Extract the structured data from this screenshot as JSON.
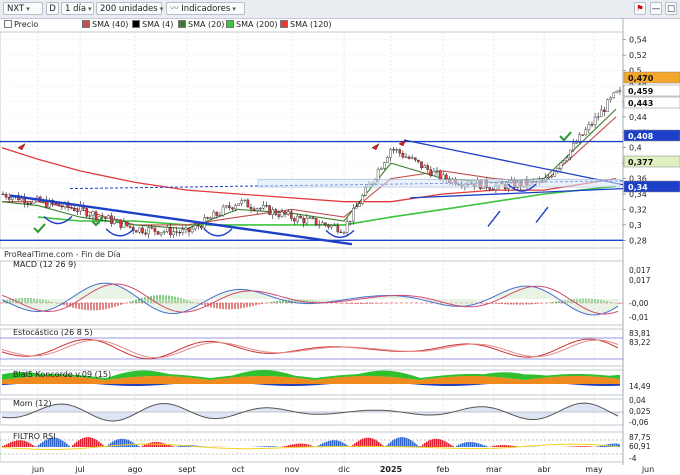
{
  "toolbar": {
    "ticker": "NXT",
    "d_label": "D",
    "period": "1 día",
    "units": "200 unidades",
    "indicators": "Indicadores"
  },
  "legend": {
    "items": [
      {
        "label": "Precio",
        "color": "#ffffff"
      },
      {
        "label": "SMA (40)",
        "color": "#c0504d"
      },
      {
        "label": "SMA (4)",
        "color": "#000000"
      },
      {
        "label": "SMA (20)",
        "color": "#3a7d2a"
      },
      {
        "label": "SMA (200)",
        "color": "#e23a3a"
      },
      {
        "label": "SMA (120)",
        "color": "#e23a3a"
      }
    ]
  },
  "panels": {
    "watermark": "ProRealTime.com - Fin de Día",
    "macd": "MACD (12 26 9)",
    "stoch": "Estocástico (26 8 5)",
    "koncorde": "Blai5 Koncorde v.09 (15)",
    "mom": "Mom (12)",
    "rsi": "FILTRO RSI"
  },
  "months": [
    "jun",
    "jul",
    "ago",
    "sept",
    "oct",
    "nov",
    "dic",
    "2025",
    "feb",
    "mar",
    "abr",
    "may",
    "jun"
  ],
  "price_axis": {
    "ticks": [
      "0,54",
      "0,52",
      "0,5",
      "0,48",
      "0,46",
      "0,44",
      "0,42",
      "0,4",
      "0,38",
      "0,36",
      "0,34",
      "0,32",
      "0,3",
      "0,28"
    ],
    "badges": [
      {
        "text": "0,470",
        "color": "#f4a62a"
      },
      {
        "text": "0,459",
        "color": "#ffffff"
      },
      {
        "text": "0,443",
        "color": "#ffffff"
      },
      {
        "text": "0,408",
        "color": "#1e3fc8"
      },
      {
        "text": "0,377",
        "color": "#e0f0c0"
      },
      {
        "text": "0,34",
        "color": "#1e3fc8"
      }
    ]
  },
  "macd_axis": {
    "ticks": [
      "0,017",
      "0,017",
      "-0,00",
      "-0,01"
    ]
  },
  "stoch_axis": {
    "ticks": [
      "83,81",
      "83,22"
    ]
  },
  "koncorde_axis": {
    "ticks": [
      "14,49"
    ]
  },
  "mom_axis": {
    "ticks": [
      "0,04",
      "0,025",
      "-0,06"
    ]
  },
  "rsi_axis": {
    "ticks": [
      "87,75",
      "60,91",
      "-4"
    ]
  },
  "colors": {
    "up": "#ffffff",
    "down": "#e23a3a",
    "support": "#1e3fc8",
    "sma40": "#c0504d",
    "sma20": "#3a7d2a",
    "sma200": "#3cc43c"
  },
  "chart_data": {
    "type": "line",
    "title": "NXT",
    "xlabel": "",
    "ylabel": "",
    "ylim": [
      0.27,
      0.55
    ],
    "grid": true,
    "x": [
      "2024-05",
      "2024-06",
      "2024-07",
      "2024-08",
      "2024-09",
      "2024-10",
      "2024-11",
      "2024-12",
      "2025-01",
      "2025-02",
      "2025-03",
      "2025-04",
      "2025-05"
    ],
    "series": [
      {
        "name": "Precio",
        "values": [
          0.34,
          0.33,
          0.32,
          0.295,
          0.29,
          0.33,
          0.31,
          0.295,
          0.4,
          0.36,
          0.35,
          0.355,
          0.47
        ]
      },
      {
        "name": "SMA (40)",
        "values": [
          0.33,
          0.33,
          0.32,
          0.3,
          0.3,
          0.31,
          0.32,
          0.31,
          0.36,
          0.37,
          0.36,
          0.355,
          0.44
        ]
      },
      {
        "name": "SMA (20)",
        "values": [
          0.33,
          0.325,
          0.31,
          0.3,
          0.295,
          0.32,
          0.315,
          0.305,
          0.38,
          0.36,
          0.355,
          0.36,
          0.45
        ]
      },
      {
        "name": "SMA (200)",
        "values": [
          null,
          0.31,
          0.305,
          0.305,
          0.3,
          0.3,
          0.3,
          0.3,
          0.31,
          0.32,
          0.33,
          0.34,
          0.35
        ]
      },
      {
        "name": "SMA (120)",
        "values": [
          0.4,
          0.385,
          0.37,
          0.355,
          0.345,
          0.34,
          0.335,
          0.33,
          0.33,
          0.34,
          0.345,
          0.345,
          0.36
        ]
      }
    ]
  }
}
